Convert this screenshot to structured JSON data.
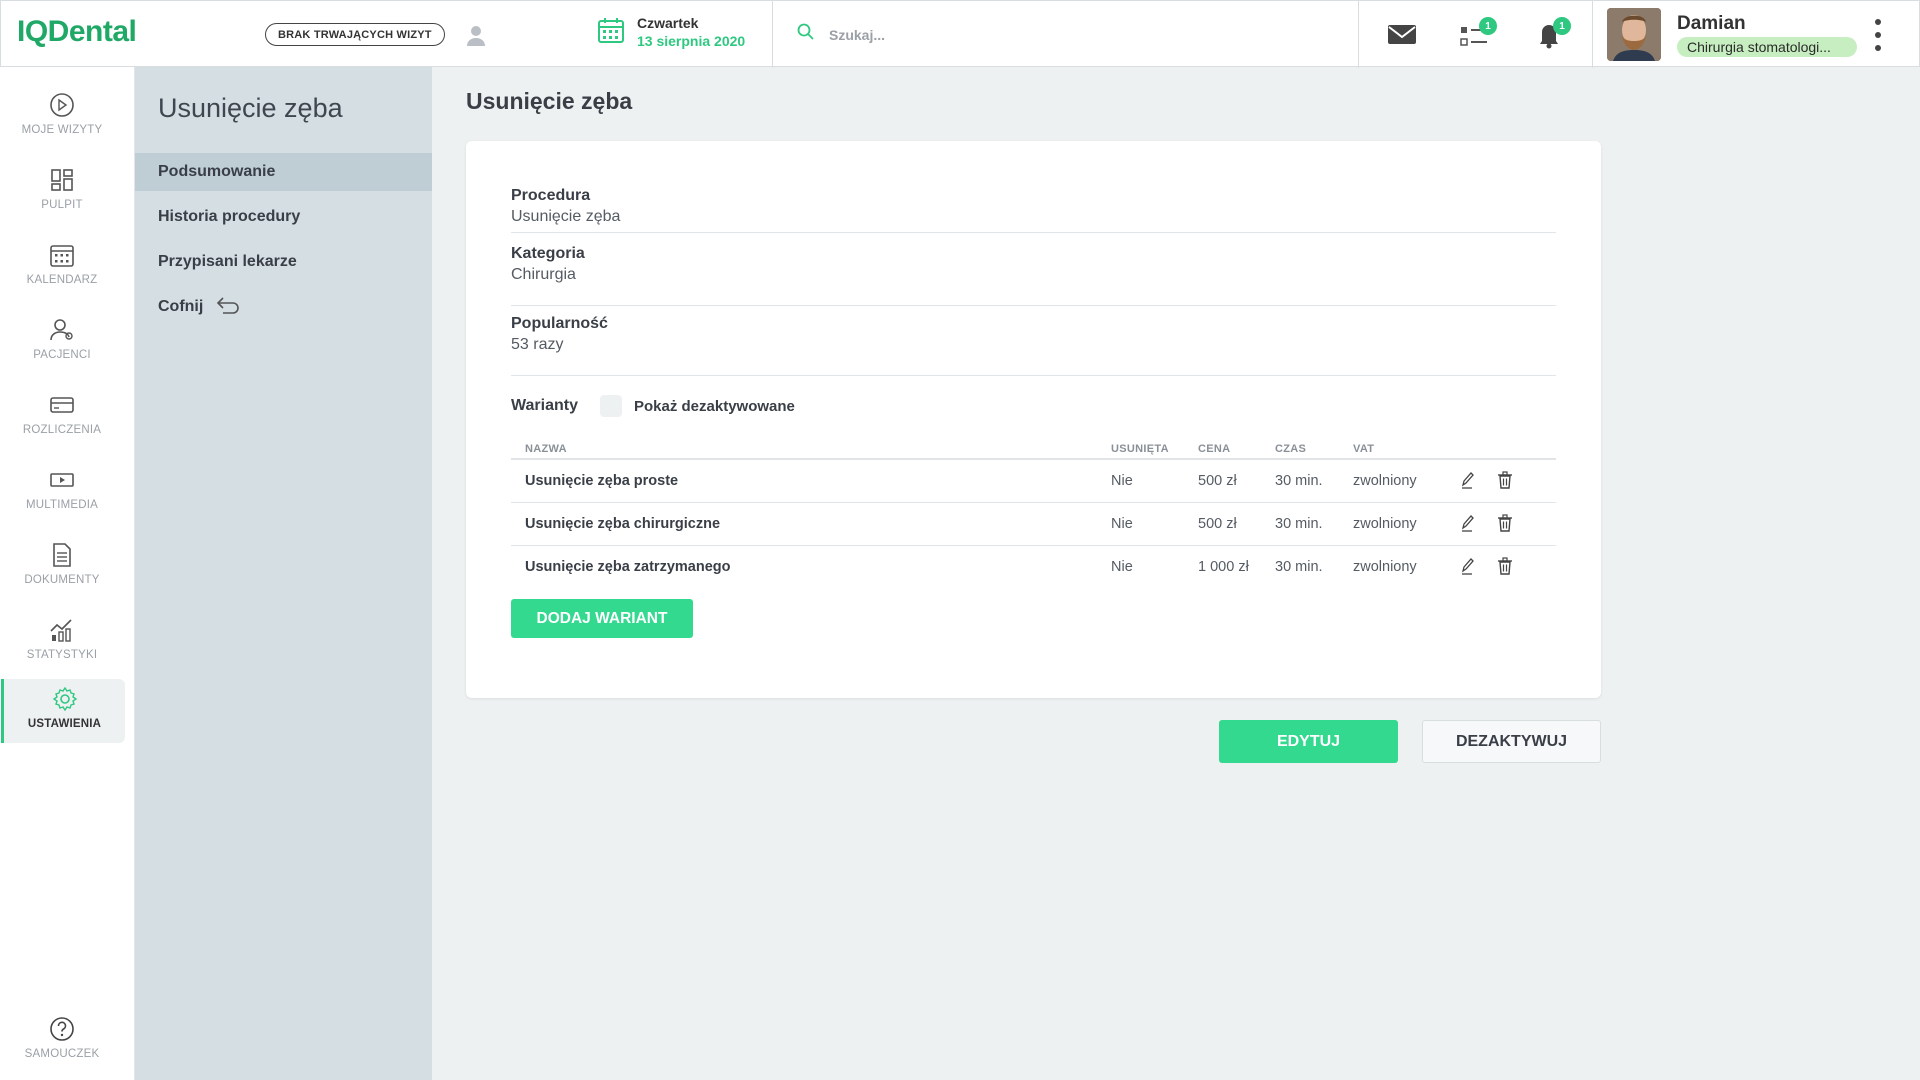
{
  "header": {
    "logo": "IQDental",
    "visit_status": "BRAK TRWAJĄCYCH WIZYT",
    "day": "Czwartek",
    "date": "13 sierpnia 2020",
    "search_placeholder": "Szukaj...",
    "tasks_badge": "1",
    "notifications_badge": "1",
    "user_name": "Damian",
    "user_role": "Chirurgia stomatologi..."
  },
  "leftnav": [
    {
      "label": "MOJE WIZYTY",
      "icon": "play-circle-icon"
    },
    {
      "label": "PULPIT",
      "icon": "dashboard-icon"
    },
    {
      "label": "KALENDARZ",
      "icon": "calendar-icon"
    },
    {
      "label": "PACJENCI",
      "icon": "patients-icon"
    },
    {
      "label": "ROZLICZENIA",
      "icon": "credit-card-icon"
    },
    {
      "label": "MULTIMEDIA",
      "icon": "video-icon"
    },
    {
      "label": "DOKUMENTY",
      "icon": "document-icon"
    },
    {
      "label": "STATYSTYKI",
      "icon": "chart-icon"
    },
    {
      "label": "USTAWIENIA",
      "icon": "gear-icon",
      "active": true
    },
    {
      "label": "SAMOUCZEK",
      "icon": "help-icon"
    }
  ],
  "subnav": {
    "title": "Usunięcie zęba",
    "items": [
      "Podsumowanie",
      "Historia procedury",
      "Przypisani lekarze",
      "Cofnij"
    ]
  },
  "main": {
    "title": "Usunięcie zęba",
    "fields": [
      {
        "label": "Procedura",
        "value": "Usunięcie zęba"
      },
      {
        "label": "Kategoria",
        "value": "Chirurgia"
      },
      {
        "label": "Popularność",
        "value": "53 razy"
      }
    ],
    "variants_label": "Warianty",
    "show_deactivated_label": "Pokaż dezaktywowane",
    "table": {
      "headers": [
        "NAZWA",
        "USUNIĘTA",
        "CENA",
        "CZAS",
        "VAT"
      ],
      "rows": [
        [
          "Usunięcie zęba proste",
          "Nie",
          "500 zł",
          "30 min.",
          "zwolniony"
        ],
        [
          "Usunięcie zęba chirurgiczne",
          "Nie",
          "500 zł",
          "30 min.",
          "zwolniony"
        ],
        [
          "Usunięcie zęba zatrzymanego",
          "Nie",
          "1 000 zł",
          "30 min.",
          "zwolniony"
        ]
      ]
    },
    "add_variant_label": "DODAJ WARIANT",
    "edit_label": "EDYTUJ",
    "deactivate_label": "DEZAKTYWUJ"
  },
  "colors": {
    "accent": "#2ec880",
    "button_green": "#33d98f",
    "subnav_bg": "#d4dee3",
    "page_bg": "#eef1f2"
  }
}
